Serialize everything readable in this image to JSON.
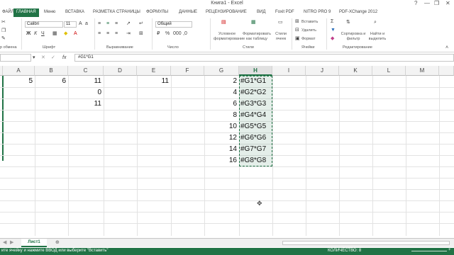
{
  "window": {
    "title": "Книга1 - Excel",
    "help": "?",
    "minimize": "—",
    "restore": "❐",
    "close": "✕"
  },
  "tabs": [
    {
      "label": "ФАЙЛ"
    },
    {
      "label": "ГЛАВНАЯ"
    },
    {
      "label": "Меню"
    },
    {
      "label": "ВСТАВКА"
    },
    {
      "label": "РАЗМЕТКА СТРАНИЦЫ"
    },
    {
      "label": "ФОРМУЛЫ"
    },
    {
      "label": "ДАННЫЕ"
    },
    {
      "label": "РЕЦЕНЗИРОВАНИЕ"
    },
    {
      "label": "ВИД"
    },
    {
      "label": "Foxit PDF"
    },
    {
      "label": "NITRO PRO 9"
    },
    {
      "label": "PDF-XChange 2012"
    }
  ],
  "ribbon": {
    "font_name": "Calibri",
    "font_size": "11",
    "number_format": "Общий",
    "groups": {
      "clipboard": "р обмена",
      "font": "Шрифт",
      "alignment": "Выравнивание",
      "number": "Число",
      "styles": "Стили",
      "cells": "Ячейки",
      "editing": "Редактирование"
    },
    "styles_buttons": [
      "Условное форматирование",
      "Форматировать как таблицу",
      "Стили ячеек"
    ],
    "cells_buttons": [
      "Вставить",
      "Удалить",
      "Формат"
    ],
    "edit_buttons": [
      "Сортировка и фильтр",
      "Найти и выделить"
    ]
  },
  "formula_bar": {
    "fx": "fx",
    "formula": "#G1*G1"
  },
  "columns": [
    "A",
    "B",
    "C",
    "D",
    "E",
    "F",
    "G",
    "H",
    "I",
    "J",
    "K",
    "L",
    "M"
  ],
  "cells": [
    {
      "ref": "A1",
      "value": "5"
    },
    {
      "ref": "B1",
      "value": "6"
    },
    {
      "ref": "C1",
      "value": "11"
    },
    {
      "ref": "E1",
      "value": "11"
    },
    {
      "ref": "C2",
      "value": "0"
    },
    {
      "ref": "C3",
      "value": "11"
    },
    {
      "ref": "G1",
      "value": "2"
    },
    {
      "ref": "G2",
      "value": "4"
    },
    {
      "ref": "G3",
      "value": "6"
    },
    {
      "ref": "G4",
      "value": "8"
    },
    {
      "ref": "G5",
      "value": "10"
    },
    {
      "ref": "G6",
      "value": "12"
    },
    {
      "ref": "G7",
      "value": "14"
    },
    {
      "ref": "G8",
      "value": "16"
    },
    {
      "ref": "H1",
      "value": "#G1*G1"
    },
    {
      "ref": "H2",
      "value": "#G2*G2"
    },
    {
      "ref": "H3",
      "value": "#G3*G3"
    },
    {
      "ref": "H4",
      "value": "#G4*G4"
    },
    {
      "ref": "H5",
      "value": "#G5*G5"
    },
    {
      "ref": "H6",
      "value": "#G6*G6"
    },
    {
      "ref": "H7",
      "value": "#G7*G7"
    },
    {
      "ref": "H8",
      "value": "#G8*G8"
    }
  ],
  "sheets": [
    {
      "label": "Лист1"
    }
  ],
  "status": {
    "message": "ите ячейку и нажмите ВВОД или выберите \"Вставить\"",
    "count": "КОЛИЧЕСТВО: 8",
    "zoom": "+"
  }
}
